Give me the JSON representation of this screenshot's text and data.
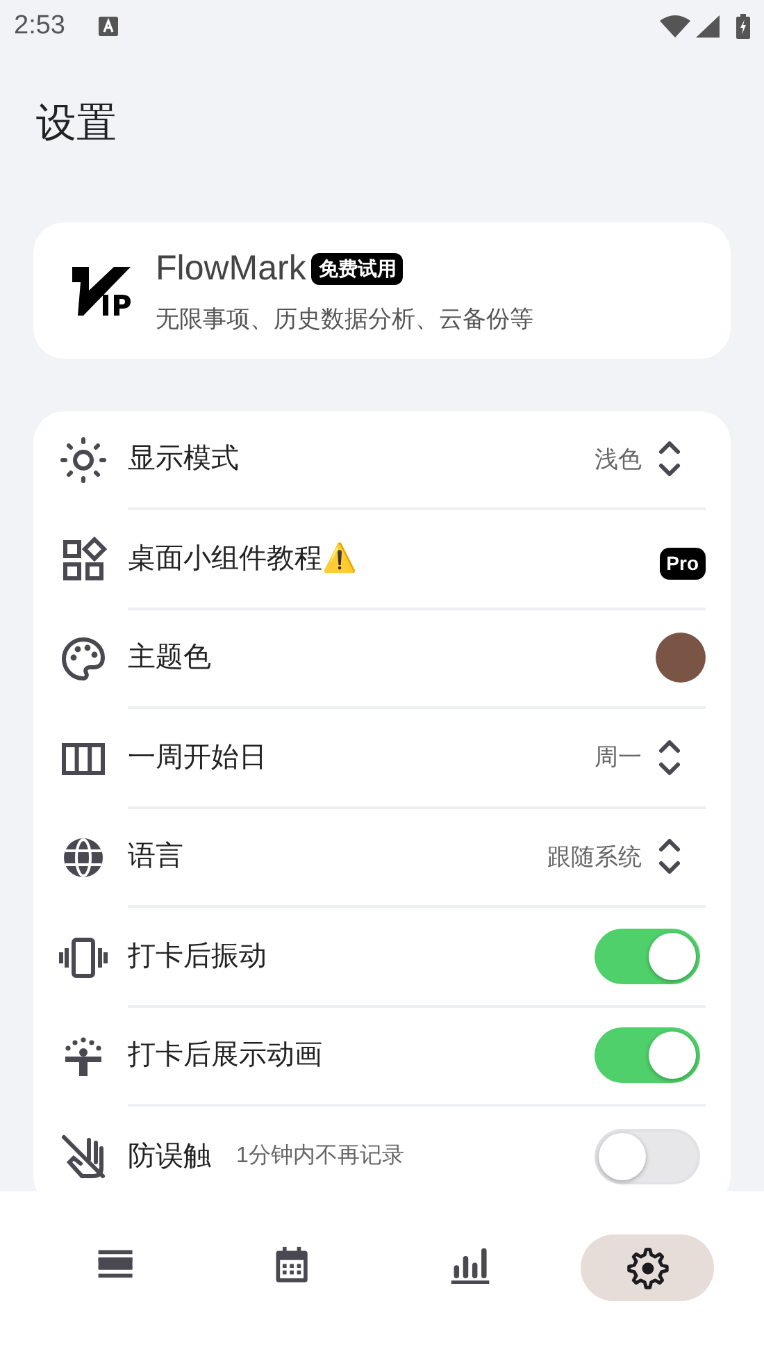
{
  "status_bar": {
    "time": "2:53"
  },
  "title": "设置",
  "vip": {
    "name": "FlowMark",
    "badge": "免费试用",
    "description": "无限事项、历史数据分析、云备份等"
  },
  "settings": [
    {
      "kind": "select",
      "label": "显示模式",
      "value": "浅色"
    },
    {
      "kind": "pro",
      "label": "桌面小组件教程⚠️",
      "badge": "Pro"
    },
    {
      "kind": "color",
      "label": "主题色",
      "color": "#7a5546"
    },
    {
      "kind": "select",
      "label": "一周开始日",
      "value": "周一"
    },
    {
      "kind": "select",
      "label": "语言",
      "value": "跟随系统"
    },
    {
      "kind": "toggle",
      "label": "打卡后振动",
      "on": true
    },
    {
      "kind": "toggle",
      "label": "打卡后展示动画",
      "on": true
    },
    {
      "kind": "toggle",
      "label": "防误触",
      "hint": "1分钟内不再记录",
      "on": false
    }
  ],
  "bottom_nav": [
    {
      "selected": false
    },
    {
      "selected": false
    },
    {
      "selected": false
    },
    {
      "selected": true
    }
  ]
}
